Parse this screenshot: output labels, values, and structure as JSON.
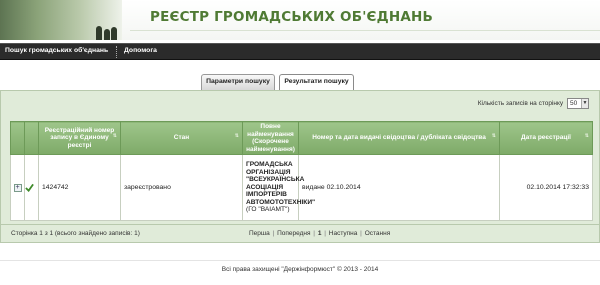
{
  "header": {
    "title": "РЕЄСТР ГРОМАДСЬКИХ ОБ'ЄДНАНЬ"
  },
  "nav": {
    "items": [
      {
        "label": "Пошук громадських об'єднань"
      },
      {
        "label": "Допомога"
      }
    ]
  },
  "tabs": [
    {
      "label": "Параметри пошуку",
      "active": false
    },
    {
      "label": "Результати пошуку",
      "active": true
    }
  ],
  "per_page": {
    "label": "Кількість записів на сторінку",
    "value": "50"
  },
  "table": {
    "headers": {
      "reg_number": "Реєстраційний номер запису в Єдиному реєстрі",
      "status": "Стан",
      "full_name": "Повне найменування (Скорочене найменування)",
      "certificate": "Номер та дата видачі свідоцтва / дубліката свідоцтва",
      "reg_date": "Дата реєстрації"
    },
    "rows": [
      {
        "reg_number": "1424742",
        "status": "зареєстровано",
        "full_name": "ГРОМАДСЬКА ОРГАНІЗАЦІЯ \"ВСЕУКРАЇНСЬКА АСОЦІАЦІЯ ІМПОРТЕРІВ АВТОМОТОТЕХНІКИ\"",
        "short_name": "(ГО \"ВАІАМТ\")",
        "certificate": "видане 02.10.2014",
        "reg_date": "02.10.2014 17:32:33"
      }
    ]
  },
  "footer": {
    "records_info": "Сторінка 1 з 1 (всього знайдено записів: 1)",
    "pager": {
      "first": "Перша",
      "prev": "Попередня",
      "current": "1",
      "next": "Наступна",
      "last": "Остання"
    }
  },
  "copyright": "Всі права захищені \"Держінформюст\" © 2013 - 2014",
  "colors": {
    "brand_green": "#4f7a34",
    "header_green": "#8bb677",
    "panel_bg": "#e0ebd9",
    "nav_bg": "#2b2b2b"
  },
  "icons": {
    "expand": "plus-icon",
    "status": "check-icon",
    "sort": "sort-arrow-icon",
    "dropdown": "chevron-down-icon"
  }
}
